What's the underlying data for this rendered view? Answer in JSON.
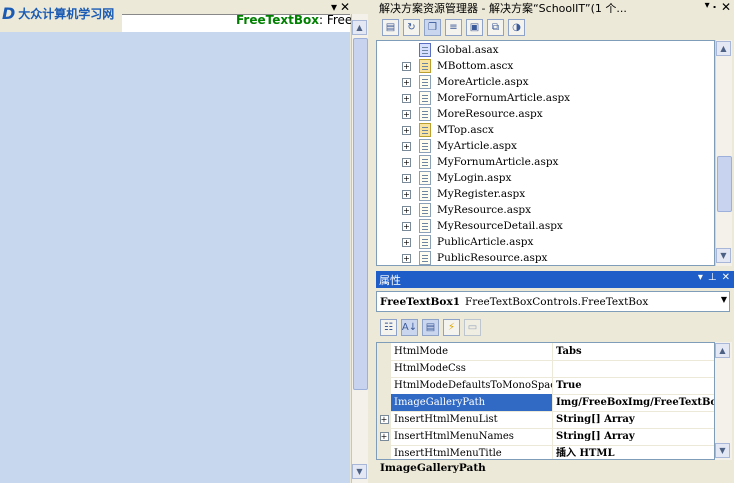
{
  "left_pane": {
    "logo_text": "大众计算机学习网",
    "logo_mark": "D",
    "control_label": "FreeTextBox",
    "control_suffix": ": Free",
    "pin_glyph": "▾",
    "close_glyph": "✕"
  },
  "solution_explorer": {
    "title": "解决方案资源管理器 - 解决方案“SchoolIT”(1 个...",
    "pin_glyph": "▾ 📌",
    "close_glyph": "✕",
    "toolbar": [
      "properties",
      "refresh",
      "show-all-files",
      "view-code",
      "view-designer",
      "copy-website",
      "asp-config"
    ],
    "items": [
      {
        "label": "Global.asax",
        "type": "asax",
        "expandable": false
      },
      {
        "label": "MBottom.ascx",
        "type": "ascx",
        "expandable": true
      },
      {
        "label": "MoreArticle.aspx",
        "type": "aspx",
        "expandable": true
      },
      {
        "label": "MoreFornumArticle.aspx",
        "type": "aspx",
        "expandable": true
      },
      {
        "label": "MoreResource.aspx",
        "type": "aspx",
        "expandable": true
      },
      {
        "label": "MTop.ascx",
        "type": "ascx",
        "expandable": true
      },
      {
        "label": "MyArticle.aspx",
        "type": "aspx",
        "expandable": true
      },
      {
        "label": "MyFornumArticle.aspx",
        "type": "aspx",
        "expandable": true
      },
      {
        "label": "MyLogin.aspx",
        "type": "aspx",
        "expandable": true
      },
      {
        "label": "MyRegister.aspx",
        "type": "aspx",
        "expandable": true
      },
      {
        "label": "MyResource.aspx",
        "type": "aspx",
        "expandable": true
      },
      {
        "label": "MyResourceDetail.aspx",
        "type": "aspx",
        "expandable": true
      },
      {
        "label": "PublicArticle.aspx",
        "type": "aspx",
        "expandable": true
      },
      {
        "label": "PublicResource.aspx",
        "type": "aspx",
        "expandable": true
      }
    ]
  },
  "properties": {
    "title": "属性",
    "object_name": "FreeTextBox1",
    "object_type": "FreeTextBoxControls.FreeTextBox",
    "rows": [
      {
        "name": "HtmlMode",
        "value": "Tabs",
        "expandable": false,
        "selected": false
      },
      {
        "name": "HtmlModeCss",
        "value": "",
        "expandable": false,
        "selected": false
      },
      {
        "name": "HtmlModeDefaultsToMonoSpaceFont",
        "value": "True",
        "expandable": false,
        "selected": false
      },
      {
        "name": "ImageGalleryPath",
        "value": "Img/FreeBoxImg/FreeTextBox",
        "expandable": false,
        "selected": true
      },
      {
        "name": "InsertHtmlMenuList",
        "value": "String[] Array",
        "expandable": true,
        "selected": false
      },
      {
        "name": "InsertHtmlMenuNames",
        "value": "String[] Array",
        "expandable": true,
        "selected": false
      },
      {
        "name": "InsertHtmlMenuTitle",
        "value": "插入 HTML",
        "expandable": false,
        "selected": false
      }
    ],
    "description_title": "ImageGalleryPath"
  }
}
